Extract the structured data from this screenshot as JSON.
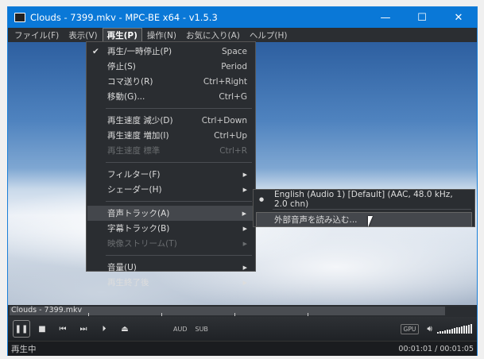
{
  "window": {
    "title": "Clouds - 7399.mkv - MPC-BE x64 - v1.5.3",
    "controls": [
      "—",
      "☐",
      "✕"
    ]
  },
  "menubar": [
    "ファイル(F)",
    "表示(V)",
    "再生(P)",
    "操作(N)",
    "お気に入り(A)",
    "ヘルプ(H)"
  ],
  "play_menu": {
    "g1": [
      {
        "label": "再生/一時停止(P)",
        "shortcut": "Space",
        "check": "✔"
      },
      {
        "label": "停止(S)",
        "shortcut": "Period"
      },
      {
        "label": "コマ送り(R)",
        "shortcut": "Ctrl+Right"
      },
      {
        "label": "移動(G)...",
        "shortcut": "Ctrl+G"
      }
    ],
    "g2": [
      {
        "label": "再生速度 減少(D)",
        "shortcut": "Ctrl+Down"
      },
      {
        "label": "再生速度 増加(I)",
        "shortcut": "Ctrl+Up"
      },
      {
        "label": "再生速度 標準",
        "shortcut": "Ctrl+R"
      }
    ],
    "g3": [
      {
        "label": "フィルター(F)"
      },
      {
        "label": "シェーダー(H)"
      }
    ],
    "g4": [
      {
        "label": "音声トラック(A)"
      },
      {
        "label": "字幕トラック(B)"
      },
      {
        "label": "映像ストリーム(T)"
      }
    ],
    "g5": [
      {
        "label": "音量(U)"
      },
      {
        "label": "再生終了後"
      }
    ]
  },
  "audio_submenu": {
    "track": "English (Audio 1) [Default] (AAC, 48.0 kHz, 2.0 chn)",
    "bullet": "●",
    "load": "外部音声を読み込む..."
  },
  "seekbar": {
    "filename": "Clouds - 7399.mkv",
    "progress": 0.938
  },
  "controls": {
    "aud": "AUD",
    "sub": "SUB",
    "gpu": "GPU",
    "volume_level": 1.0
  },
  "status": {
    "state": "再生中",
    "time": "00:01:01 / 00:01:05"
  }
}
